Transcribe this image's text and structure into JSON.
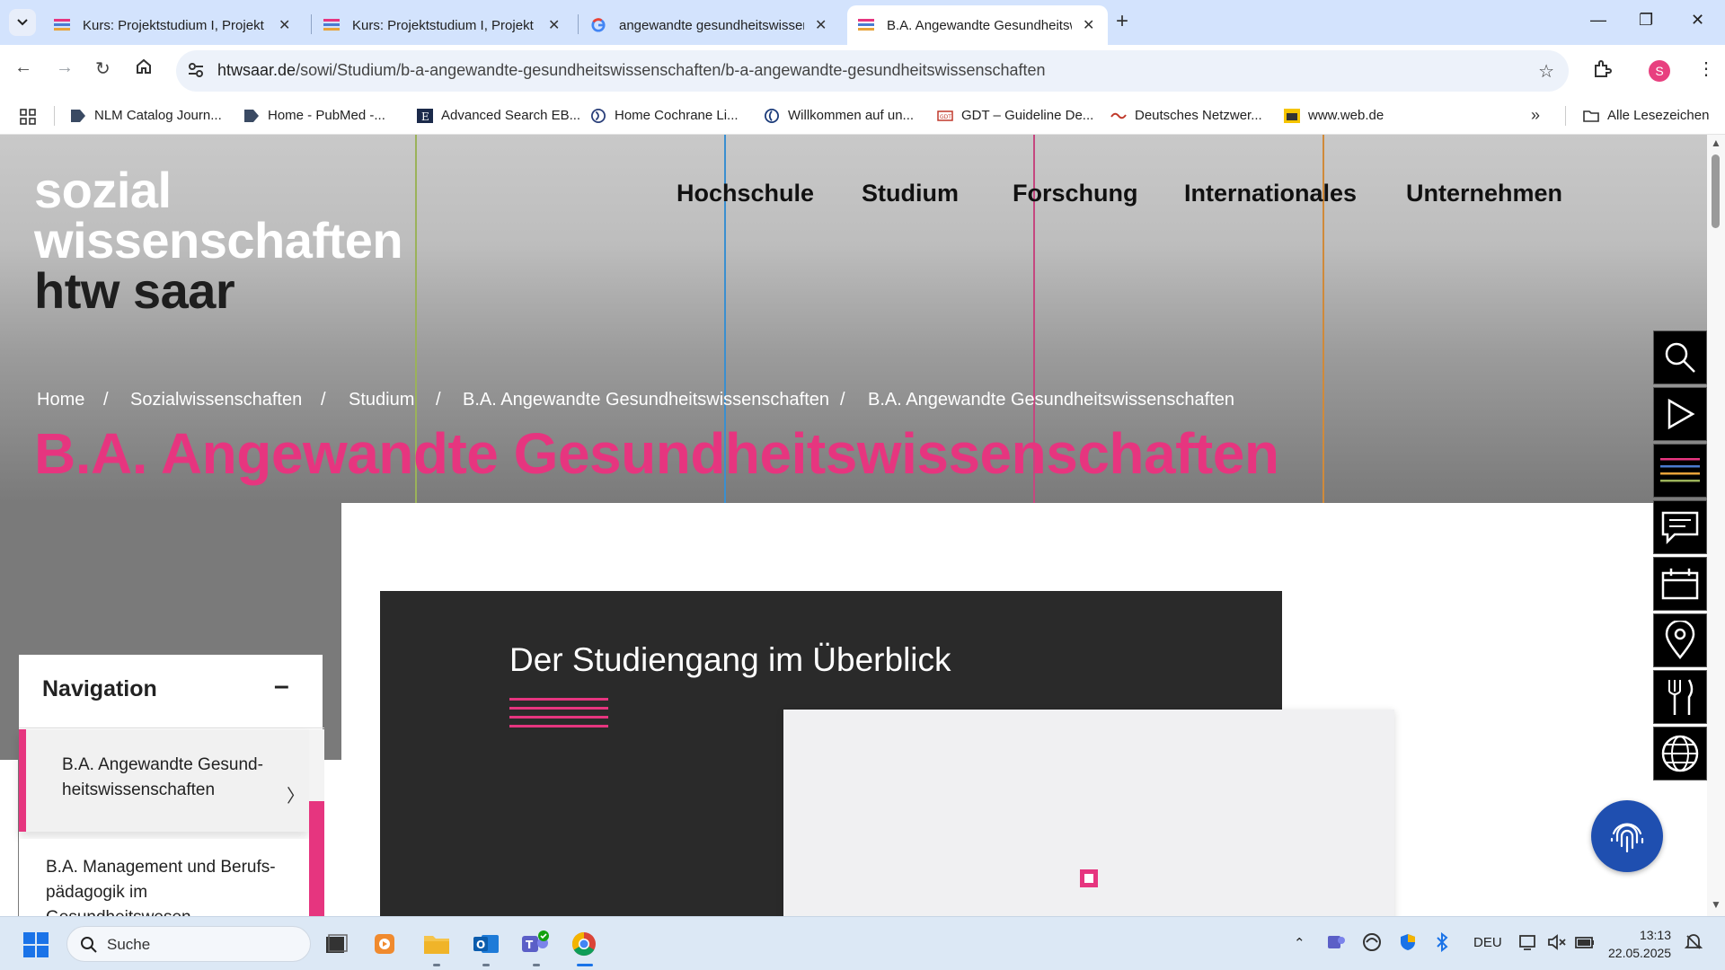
{
  "tabs": [
    {
      "title": "Kurs: Projektstudium I, Projekt (",
      "active": false
    },
    {
      "title": "Kurs: Projektstudium I, Projekt (",
      "active": false
    },
    {
      "title": "angewandte gesundheitswissen",
      "active": false
    },
    {
      "title": "B.A. Angewandte Gesundheitsw",
      "active": true
    }
  ],
  "omnibox": {
    "domain": "htwsaar.de",
    "path": "/sowi/Studium/b-a-angewandte-gesundheitswissenschaften/b-a-angewandte-gesundheitswissenschaften"
  },
  "profile_initial": "S",
  "bookmarks": [
    {
      "label": "NLM Catalog Journ..."
    },
    {
      "label": "Home - PubMed -..."
    },
    {
      "label": "Advanced Search EB..."
    },
    {
      "label": "Home  Cochrane Li..."
    },
    {
      "label": "Willkommen auf un..."
    },
    {
      "label": "GDT – Guideline De..."
    },
    {
      "label": "Deutsches Netzwer..."
    },
    {
      "label": "www.web.de"
    }
  ],
  "all_bookmarks": "Alle Lesezeichen",
  "site": {
    "logo_line1": "sozial",
    "logo_line2": "wissenschaften",
    "logo_line3": "htw saar",
    "mainnav": [
      "Hochschule",
      "Studium",
      "Forschung",
      "Internationales",
      "Unternehmen"
    ],
    "breadcrumb": [
      "Home",
      "Sozialwissenschaften",
      "Studium",
      "B.A. Angewandte Gesundheitswissenschaften",
      "B.A. Angewandte Gesundheitswissenschaften"
    ],
    "breadcrumb_sep": "/",
    "page_title": "B.A. Angewandte Gesundheitswissenschaften",
    "nav_title": "Navigation",
    "nav_toggle": "–",
    "nav_items": [
      "B.A. Angewandte Gesund-heitswissenschaften",
      "B.A. Management und Berufs-pädagogik im Gesundheitswesen"
    ],
    "card_title": "Der Studiengang im Überblick"
  },
  "colors": {
    "accent": "#e6357f",
    "dark": "#2a2a2a"
  },
  "taskbar": {
    "search_placeholder": "Suche",
    "lang": "DEU",
    "time": "13:13",
    "date": "22.05.2025"
  }
}
